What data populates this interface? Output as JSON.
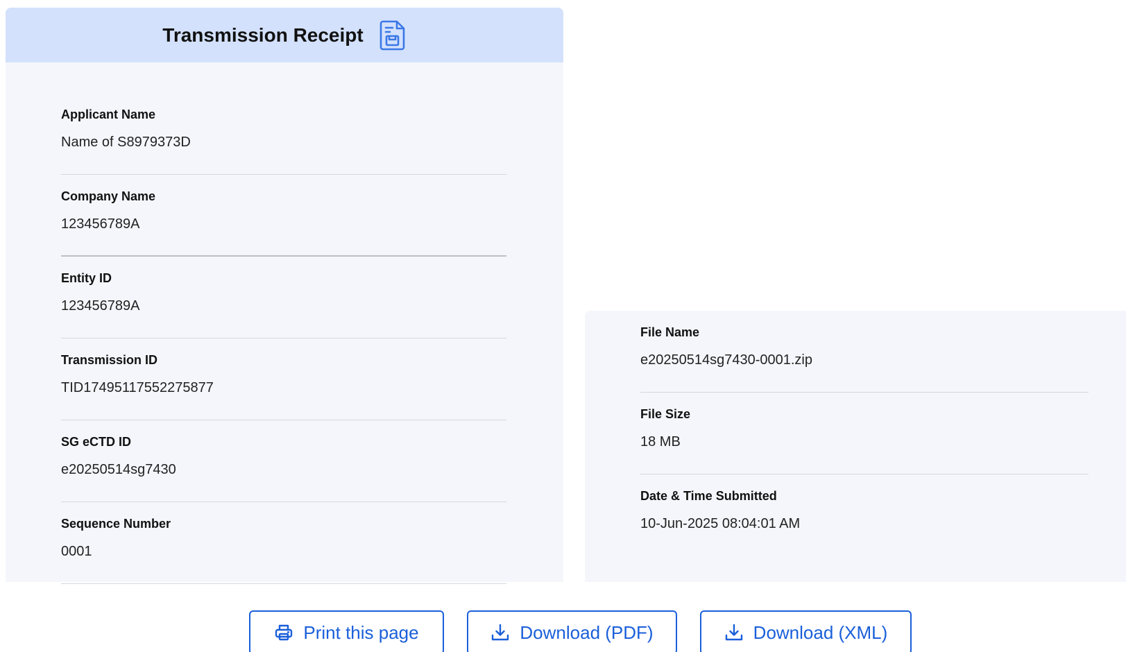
{
  "receipt": {
    "title": "Transmission Receipt",
    "title_icon": "receipt-document-icon"
  },
  "left_fields": [
    {
      "label": "Applicant Name",
      "value": "Name of S8979373D"
    },
    {
      "label": "Company Name",
      "value": "123456789A"
    },
    {
      "label": "Entity ID",
      "value": "123456789A"
    },
    {
      "label": "Transmission ID",
      "value": "TID17495117552275877"
    },
    {
      "label": "SG eCTD ID",
      "value": "e20250514sg7430"
    },
    {
      "label": "Sequence Number",
      "value": "0001"
    }
  ],
  "right_fields": [
    {
      "label": "File Name",
      "value": "e20250514sg7430-0001.zip"
    },
    {
      "label": "File Size",
      "value": "18 MB"
    },
    {
      "label": "Date & Time Submitted",
      "value": "10-Jun-2025 08:04:01 AM"
    }
  ],
  "actions": {
    "print_label": "Print this page",
    "print_icon": "printer-icon",
    "pdf_label": "Download (PDF)",
    "pdf_icon": "download-icon",
    "xml_label": "Download (XML)",
    "xml_icon": "download-icon"
  },
  "colors": {
    "header_bg": "#d3e1fc",
    "panel_bg": "#f4f6fb",
    "accent": "#1a5fd9"
  }
}
